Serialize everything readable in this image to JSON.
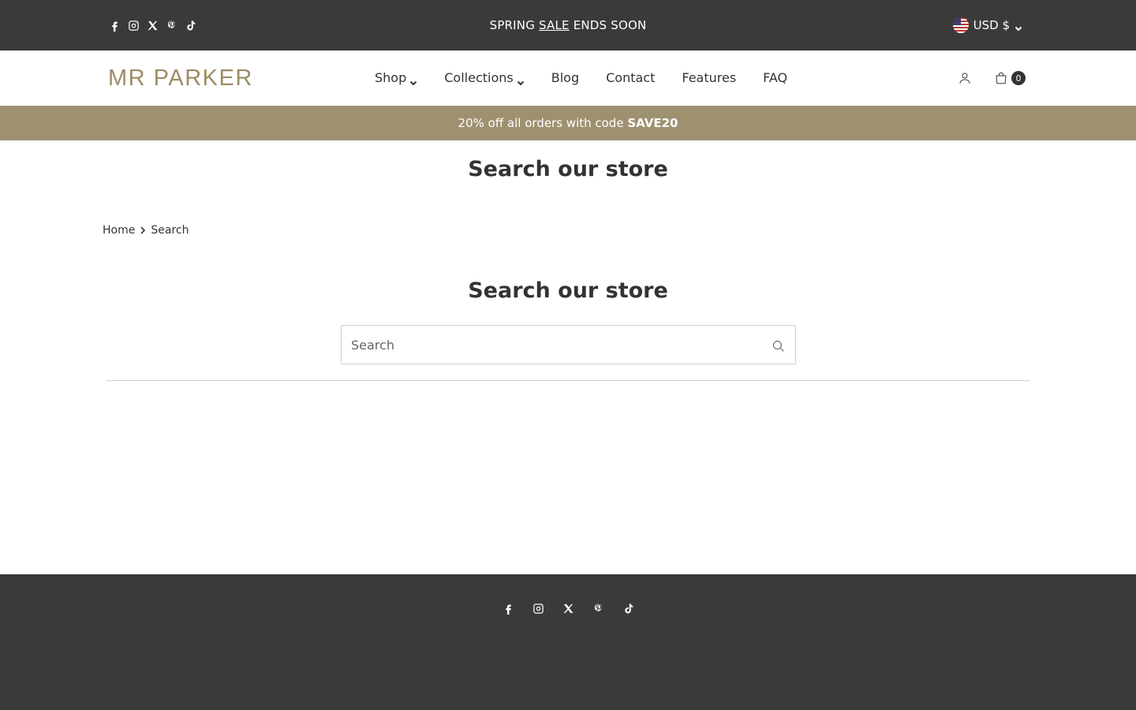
{
  "topbar": {
    "socials": [
      "facebook-icon",
      "instagram-icon",
      "x-twitter-icon",
      "pinterest-icon",
      "tiktok-icon"
    ],
    "announcement": {
      "before": "SPRING ",
      "sale": "SALE",
      "after": " ENDS SOON"
    },
    "currency": "USD $"
  },
  "header": {
    "logo": "MR PARKER",
    "nav": [
      {
        "label": "Shop",
        "dropdown": true
      },
      {
        "label": "Collections",
        "dropdown": true
      },
      {
        "label": "Blog",
        "dropdown": false
      },
      {
        "label": "Contact",
        "dropdown": false
      },
      {
        "label": "Features",
        "dropdown": false
      },
      {
        "label": "FAQ",
        "dropdown": false
      }
    ],
    "cart_count": "0"
  },
  "promo": {
    "text": "20% off all orders with code ",
    "code": "SAVE20"
  },
  "main": {
    "page_title": "Search our store",
    "breadcrumb": {
      "home": "Home",
      "current": "Search"
    },
    "section_title": "Search our store",
    "search": {
      "placeholder": "Search",
      "value": ""
    }
  },
  "footer": {
    "socials": [
      "facebook-icon",
      "instagram-icon",
      "x-twitter-icon",
      "pinterest-icon",
      "tiktok-icon"
    ]
  },
  "colors": {
    "topbar_bg": "#3a3a3a",
    "brand_gold": "#9c8c64",
    "promo_bg": "#9e9170",
    "footer_bg": "#3a3a3a",
    "text": "#333333"
  }
}
